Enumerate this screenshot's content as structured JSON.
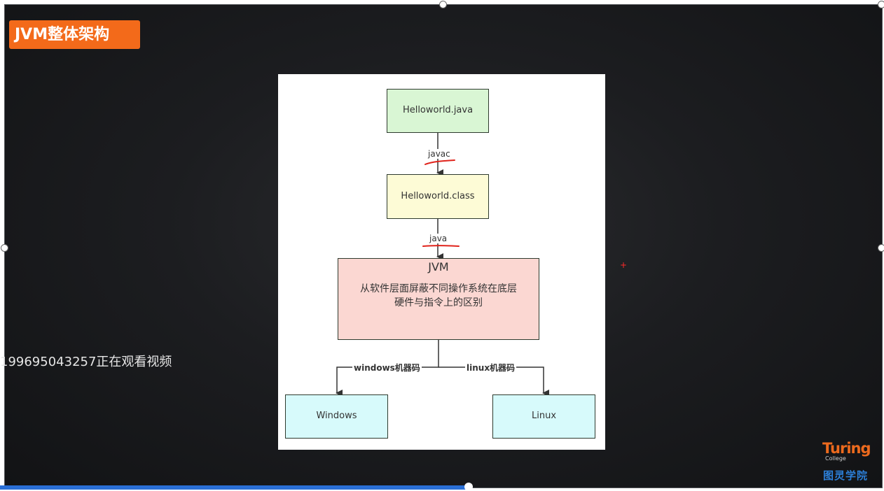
{
  "header": {
    "title": "JVM整体架构"
  },
  "diagram": {
    "nodes": {
      "source": "Helloworld.java",
      "bytecode": "Helloworld.class",
      "jvm_title": "JVM",
      "jvm_desc_line1": "从软件层面屏蔽不同操作系统在底层",
      "jvm_desc_line2": "硬件与指令上的区别",
      "windows": "Windows",
      "linux": "Linux"
    },
    "edges": {
      "compile": "javac",
      "run": "java",
      "to_windows": "windows机器码",
      "to_linux": "linux机器码"
    }
  },
  "overlay": {
    "viewer_notice": "199695043257正在观看视频"
  },
  "logo": {
    "main": "Turing",
    "sub": "College",
    "cn": "图灵学院"
  },
  "playback": {
    "progress": 0.53
  },
  "colors": {
    "badge": "#f36a1a",
    "node_green": "#d9f6d4",
    "node_yellow": "#fdfbd6",
    "node_pink": "#fbd7d2",
    "node_cyan": "#d7fafb",
    "annotation_red": "#e0231b",
    "logo_orange": "#ec6a1e",
    "logo_blue": "#2c7fd8"
  }
}
